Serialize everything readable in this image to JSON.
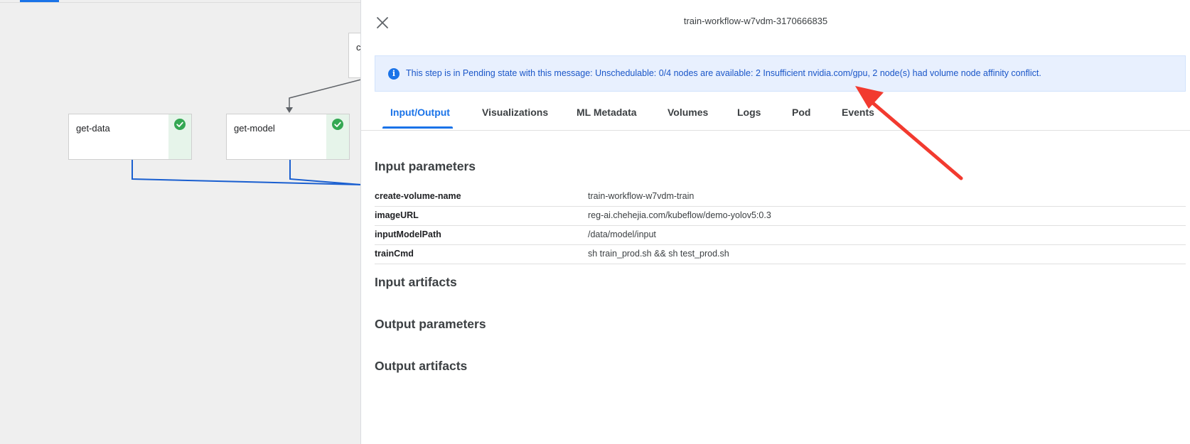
{
  "graph": {
    "nodes": [
      {
        "label": "get-data",
        "status": "succeeded"
      },
      {
        "label": "get-model",
        "status": "succeeded"
      },
      {
        "label": "c",
        "status": ""
      }
    ]
  },
  "panel": {
    "title": "train-workflow-w7vdm-3170666835",
    "banner": {
      "icon": "info-icon",
      "icon_glyph": "i",
      "message": "This step is in Pending state with this message: Unschedulable: 0/4 nodes are available: 2 Insufficient nvidia.com/gpu, 2 node(s) had volume node affinity conflict."
    },
    "tabs": [
      {
        "label": "Input/Output",
        "active": true
      },
      {
        "label": "Visualizations",
        "active": false
      },
      {
        "label": "ML Metadata",
        "active": false
      },
      {
        "label": "Volumes",
        "active": false
      },
      {
        "label": "Logs",
        "active": false
      },
      {
        "label": "Pod",
        "active": false
      },
      {
        "label": "Events",
        "active": false
      }
    ],
    "sections": {
      "input_parameters": "Input parameters",
      "input_artifacts": "Input artifacts",
      "output_parameters": "Output parameters",
      "output_artifacts": "Output artifacts"
    },
    "input_parameters": [
      {
        "key": "create-volume-name",
        "value": "train-workflow-w7vdm-train"
      },
      {
        "key": "imageURL",
        "value": "reg-ai.chehejia.com/kubeflow/demo-yolov5:0.3"
      },
      {
        "key": "inputModelPath",
        "value": "/data/model/input"
      },
      {
        "key": "trainCmd",
        "value": "sh train_prod.sh && sh test_prod.sh"
      }
    ]
  },
  "colors": {
    "accent": "#1a73e8",
    "success": "#34a853",
    "success_bg": "#e6f4ea",
    "banner_bg": "#e8f0fe",
    "annotation_arrow": "#f23a2f",
    "edge_blue": "#1a5fd0",
    "edge_gray": "#5f6368"
  }
}
